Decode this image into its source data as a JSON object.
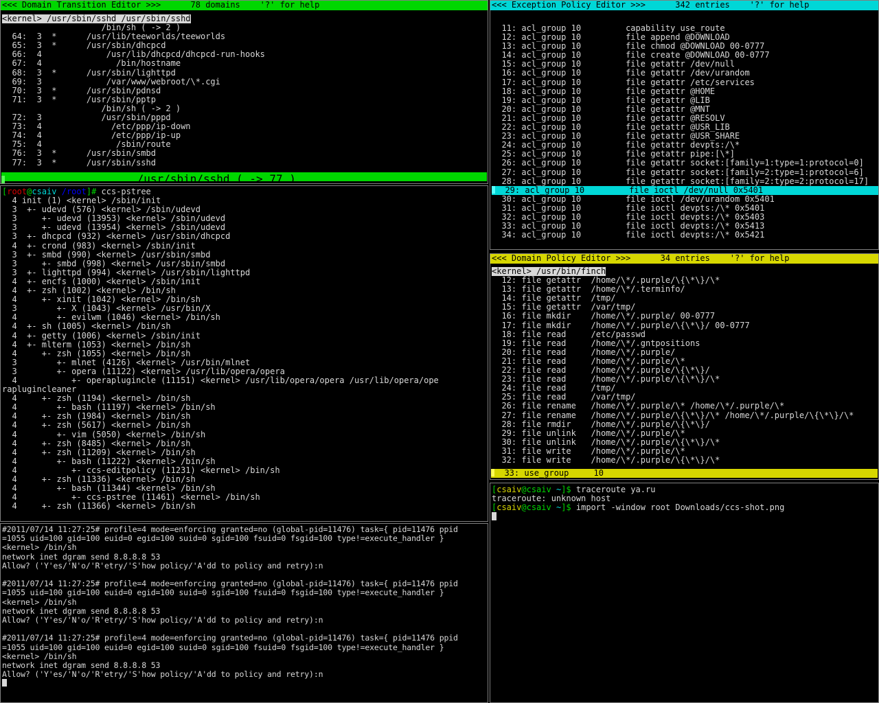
{
  "colors": {
    "green": "#00d700",
    "cyan": "#00d7d7",
    "yellow": "#d7d700",
    "fg": "#d8d8d8",
    "bg": "#000000",
    "border": "#808080",
    "prompt_red": "#d70000",
    "prompt_blue": "#0000ff"
  },
  "domain_transition_editor": {
    "header": "<<< Domain Transition Editor >>>      78 domains    '?' for help",
    "header_title": "<<< Domain Transition Editor >>>",
    "header_count": "78 domains",
    "header_help": "'?' for help",
    "current_domain": "<kernel> /usr/sbin/sshd /usr/sbin/sshd",
    "subline": "                    /bin/sh ( -> 2 )",
    "rows": [
      "  64:  3  *      /usr/lib/teeworlds/teeworlds",
      "  65:  3  *      /usr/sbin/dhcpcd",
      "  66:  4             /usr/lib/dhcpcd/dhcpcd-run-hooks",
      "  67:  4               /bin/hostname",
      "  68:  3  *      /usr/sbin/lighttpd",
      "  69:  3             /var/www/webroot/\\*.cgi",
      "  70:  3  *      /usr/sbin/pdnsd",
      "  71:  3  *      /usr/sbin/pptp",
      "                    /bin/sh ( -> 2 )",
      "  72:  3            /usr/sbin/pppd",
      "  73:  4              /etc/ppp/ip-down",
      "  74:  4              /etc/ppp/ip-up",
      "  75:  4               /sbin/route",
      "  76:  3  *      /usr/sbin/smbd",
      "  77:  3  *      /usr/sbin/sshd"
    ],
    "selected_row": "                    /usr/sbin/sshd ( -> 77 )"
  },
  "pstree": {
    "prompt": {
      "br_open": "[",
      "user": "root",
      "at": "@",
      "host": "csaiv",
      "space": " ",
      "cwd": "/root",
      "br_close": "]#",
      "command": " ccs-pstree"
    },
    "lines": [
      "  4 init (1) <kernel> /sbin/init",
      "  3  +- udevd (576) <kernel> /sbin/udevd",
      "  3     +- udevd (13953) <kernel> /sbin/udevd",
      "  3     +- udevd (13954) <kernel> /sbin/udevd",
      "  3  +- dhcpcd (932) <kernel> /usr/sbin/dhcpcd",
      "  4  +- crond (983) <kernel> /sbin/init",
      "  3  +- smbd (990) <kernel> /usr/sbin/smbd",
      "  3     +- smbd (998) <kernel> /usr/sbin/smbd",
      "  3  +- lighttpd (994) <kernel> /usr/sbin/lighttpd",
      "  4  +- encfs (1000) <kernel> /sbin/init",
      "  4  +- zsh (1002) <kernel> /bin/sh",
      "  4     +- xinit (1042) <kernel> /bin/sh",
      "  3        +- X (1043) <kernel> /usr/bin/X",
      "  4        +- evilwm (1046) <kernel> /bin/sh",
      "  4  +- sh (1005) <kernel> /bin/sh",
      "  4  +- getty (1006) <kernel> /sbin/init",
      "  4  +- mlterm (1053) <kernel> /bin/sh",
      "  4     +- zsh (1055) <kernel> /bin/sh",
      "  3        +- mlnet (4126) <kernel> /usr/bin/mlnet",
      "  3        +- opera (11122) <kernel> /usr/lib/opera/opera",
      "  4           +- operaplugincle (11151) <kernel> /usr/lib/opera/opera /usr/lib/opera/operaplugincleaner",
      "  4     +- zsh (1194) <kernel> /bin/sh",
      "  4        +- bash (11197) <kernel> /bin/sh",
      "  4     +- zsh (1984) <kernel> /bin/sh",
      "  4     +- zsh (5617) <kernel> /bin/sh",
      "  4        +- vim (5050) <kernel> /bin/sh",
      "  4     +- zsh (8485) <kernel> /bin/sh",
      "  4     +- zsh (11209) <kernel> /bin/sh",
      "  4        +- bash (11222) <kernel> /bin/sh",
      "  4           +- ccs-editpolicy (11231) <kernel> /bin/sh",
      "  4     +- zsh (11336) <kernel> /bin/sh",
      "  4        +- bash (11344) <kernel> /bin/sh",
      "  4           +- ccs-pstree (11461) <kernel> /bin/sh",
      "  4     +- zsh (11366) <kernel> /bin/sh"
    ]
  },
  "audit_log": {
    "blocks": [
      [
        "#2011/07/14 11:27:25# profile=4 mode=enforcing granted=no (global-pid=11476) task={ pid=11476 ppid=1055 uid=100 gid=100 euid=0 egid=100 suid=0 sgid=100 fsuid=0 fsgid=100 type!=execute_handler }",
        "<kernel> /bin/sh",
        "network inet dgram send 8.8.8.8 53",
        "Allow? ('Y'es/'N'o/'R'etry/'S'how policy/'A'dd to policy and retry):n"
      ],
      [
        "#2011/07/14 11:27:25# profile=4 mode=enforcing granted=no (global-pid=11476) task={ pid=11476 ppid=1055 uid=100 gid=100 euid=0 egid=100 suid=0 sgid=100 fsuid=0 fsgid=100 type!=execute_handler }",
        "<kernel> /bin/sh",
        "network inet dgram send 8.8.8.8 53",
        "Allow? ('Y'es/'N'o/'R'etry/'S'how policy/'A'dd to policy and retry):n"
      ],
      [
        "#2011/07/14 11:27:25# profile=4 mode=enforcing granted=no (global-pid=11476) task={ pid=11476 ppid=1055 uid=100 gid=100 euid=0 egid=100 suid=0 sgid=100 fsuid=0 fsgid=100 type!=execute_handler }",
        "<kernel> /bin/sh",
        "network inet dgram send 8.8.8.8 53",
        "Allow? ('Y'es/'N'o/'R'etry/'S'how policy/'A'dd to policy and retry):n"
      ]
    ]
  },
  "exception_policy_editor": {
    "header": "<<< Exception Policy Editor >>>      342 entries    '?' for help",
    "header_title": "<<< Exception Policy Editor >>>",
    "header_count": "342 entries",
    "header_help": "'?' for help",
    "rows_before": [
      "  11: acl_group 10         capability use_route",
      "  12: acl_group 10         file append @DOWNLOAD",
      "  13: acl_group 10         file chmod @DOWNLOAD 00-0777",
      "  14: acl_group 10         file create @DOWNLOAD 00-0777",
      "  15: acl_group 10         file getattr /dev/null",
      "  16: acl_group 10         file getattr /dev/urandom",
      "  17: acl_group 10         file getattr /etc/services",
      "  18: acl_group 10         file getattr @HOME",
      "  19: acl_group 10         file getattr @LIB",
      "  20: acl_group 10         file getattr @MNT",
      "  21: acl_group 10         file getattr @RESOLV",
      "  22: acl_group 10         file getattr @USR_LIB",
      "  23: acl_group 10         file getattr @USR_SHARE",
      "  24: acl_group 10         file getattr devpts:/\\*",
      "  25: acl_group 10         file getattr pipe:[\\*]",
      "  26: acl_group 10         file getattr socket:[family=1:type=1:protocol=0]",
      "  27: acl_group 10         file getattr socket:[family=2:type=1:protocol=6]",
      "  28: acl_group 10         file getattr socket:[family=2:type=2:protocol=17]"
    ],
    "selected_row": "  29: acl_group 10         file ioctl /dev/null 0x5401",
    "rows_after": [
      "  30: acl_group 10         file ioctl /dev/urandom 0x5401",
      "  31: acl_group 10         file ioctl devpts:/\\* 0x5401",
      "  32: acl_group 10         file ioctl devpts:/\\* 0x5403",
      "  33: acl_group 10         file ioctl devpts:/\\* 0x5413",
      "  34: acl_group 10         file ioctl devpts:/\\* 0x5421"
    ]
  },
  "domain_policy_editor": {
    "header": "<<< Domain Policy Editor >>>      34 entries    '?' for help",
    "header_title": "<<< Domain Policy Editor >>>",
    "header_count": "34 entries",
    "header_help": "'?' for help",
    "current_domain": "<kernel> /usr/bin/finch",
    "rows": [
      "  12: file getattr  /home/\\*/.purple/\\{\\*\\}/\\*",
      "  13: file getattr  /home/\\*/.terminfo/",
      "  14: file getattr  /tmp/",
      "  15: file getattr  /var/tmp/",
      "  16: file mkdir    /home/\\*/.purple/ 00-0777",
      "  17: file mkdir    /home/\\*/.purple/\\{\\*\\}/ 00-0777",
      "  18: file read     /etc/passwd",
      "  19: file read     /home/\\*/.gntpositions",
      "  20: file read     /home/\\*/.purple/",
      "  21: file read     /home/\\*/.purple/\\*",
      "  22: file read     /home/\\*/.purple/\\{\\*\\}/",
      "  23: file read     /home/\\*/.purple/\\{\\*\\}/\\*",
      "  24: file read     /tmp/",
      "  25: file read     /var/tmp/",
      "  26: file rename   /home/\\*/.purple/\\* /home/\\*/.purple/\\*",
      "  27: file rename   /home/\\*/.purple/\\{\\*\\}/\\* /home/\\*/.purple/\\{\\*\\}/\\*",
      "  28: file rmdir    /home/\\*/.purple/\\{\\*\\}/",
      "  29: file unlink   /home/\\*/.purple/\\*",
      "  30: file unlink   /home/\\*/.purple/\\{\\*\\}/\\*",
      "  31: file write    /home/\\*/.purple/\\*",
      "  32: file write    /home/\\*/.purple/\\{\\*\\}/\\*"
    ],
    "selected_row": "  33: use_group     10"
  },
  "shell": {
    "prompt1": {
      "br_open": "[",
      "user": "csaiv",
      "at": "@",
      "host": "csaiv",
      "space": " ",
      "cwd": "~",
      "br_close": "]$",
      "command": " traceroute ya.ru"
    },
    "output1": "traceroute: unknown host",
    "prompt2": {
      "br_open": "[",
      "user": "csaiv",
      "at": "@",
      "host": "csaiv",
      "space": " ",
      "cwd": "~",
      "br_close": "]$",
      "command": " import -window root Downloads/ccs-shot.png"
    }
  }
}
